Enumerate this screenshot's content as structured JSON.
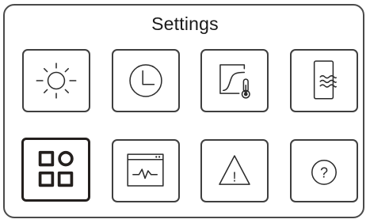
{
  "header": {
    "title": "Settings"
  },
  "menu": {
    "items": [
      {
        "id": "display",
        "icon": "sun-icon",
        "selected": false
      },
      {
        "id": "clock",
        "icon": "clock-icon",
        "selected": false
      },
      {
        "id": "temperature-curve",
        "icon": "temperature-curve-icon",
        "selected": false
      },
      {
        "id": "water-tank",
        "icon": "water-tank-icon",
        "selected": false
      },
      {
        "id": "modules",
        "icon": "grid-apps-icon",
        "selected": true
      },
      {
        "id": "monitor",
        "icon": "monitor-window-icon",
        "selected": false
      },
      {
        "id": "alarms",
        "icon": "warning-icon",
        "selected": false,
        "glyph": "!"
      },
      {
        "id": "help",
        "icon": "help-icon",
        "selected": false,
        "glyph": "?"
      }
    ]
  },
  "colors": {
    "frame": "#4a4a4a",
    "icon": "#2a2a2a",
    "selected_border": "#231f1d",
    "background": "#ffffff"
  }
}
